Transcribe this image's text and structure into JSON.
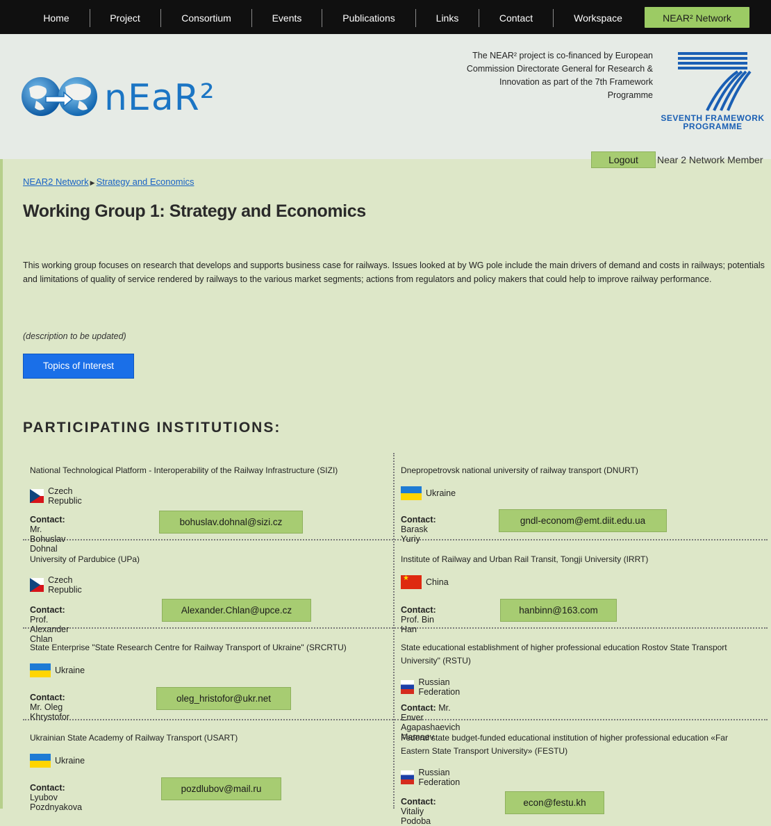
{
  "nav": {
    "items": [
      "Home",
      "Project",
      "Consortium",
      "Events",
      "Publications",
      "Links",
      "Contact",
      "Workspace"
    ],
    "active_label": "NEAR² Network",
    "active_color": "#9ccb64"
  },
  "header": {
    "logo_text": "nEaR²",
    "cofinanced_text": "The NEAR² project is co-financed by European Commission Directorate General for Research & Innovation as part of the 7th Framework Programme",
    "fp7_line1": "SEVENTH FRAMEWORK",
    "fp7_line2": "PROGRAMME"
  },
  "user": {
    "logout_label": "Logout",
    "member_label": "Near 2 Network Member"
  },
  "breadcrumb": {
    "item1": "NEAR2 Network",
    "item2": "Strategy and Economics"
  },
  "page": {
    "title": "Working Group 1: Strategy and Economics",
    "description": "This working group focuses on research that develops and supports business case for railways. Issues looked at by WG pole include the main drivers of demand and costs in railways; potentials and limitations of quality of service rendered by railways to the various market segments; actions from regulators and policy makers that could help to improve railway performance.",
    "note": "(description to be updated)",
    "topics_button": "Topics of Interest",
    "section_title": "PARTICIPATING INSTITUTIONS:"
  },
  "contact_prefix": "Contact:",
  "institutions": [
    {
      "name": "National Technological Platform - Interoperability of the Railway Infrastructure (SIZI)",
      "country": "Czech Republic",
      "flag": "cz",
      "contact": "Mr. Bohuslav Dohnal",
      "email": "bohuslav.dohnal@sizi.cz"
    },
    {
      "name": "Dnepropetrovsk national university of railway transport (DNURT)",
      "country": "Ukraine",
      "flag": "ua",
      "contact": "Barask Yuriy",
      "email": "gndl-econom@emt.diit.edu.ua"
    },
    {
      "name": "University of Pardubice (UPa)",
      "country": "Czech Republic",
      "flag": "cz",
      "contact": "Prof. Alexander Chlan",
      "email": "Alexander.Chlan@upce.cz"
    },
    {
      "name": "Institute of Railway and Urban Rail Transit, Tongji University (IRRT)",
      "country": "China",
      "flag": "cn",
      "contact": "Prof. Bin Han",
      "email": "hanbinn@163.com"
    },
    {
      "name": "State Enterprise \"State Research Centre for Railway Transport of Ukraine\"  (SRCRTU)",
      "country": "Ukraine",
      "flag": "ua",
      "contact": "Mr. Oleg Khrystofor",
      "email": "oleg_hristofor@ukr.net"
    },
    {
      "name": "State educational establishment of higher professional education Rostov  State Transport University\" (RSTU)",
      "country": "Russian Federation",
      "flag": "ru",
      "contact": "Mr. Enver Agapashaevich Mamaev",
      "email": ""
    },
    {
      "name": "Ukrainian State Academy of Railway Transport (USART)",
      "country": "Ukraine",
      "flag": "ua",
      "contact": "Lyubov Pozdnyakova",
      "email": "pozdlubov@mail.ru"
    },
    {
      "name": "Federal state budget-funded educational institution of higher professional education «Far Eastern State Transport University» (FESTU)",
      "country": "Russian Federation",
      "flag": "ru",
      "contact": "Vitaliy Podoba",
      "email": "econ@festu.kh"
    }
  ]
}
